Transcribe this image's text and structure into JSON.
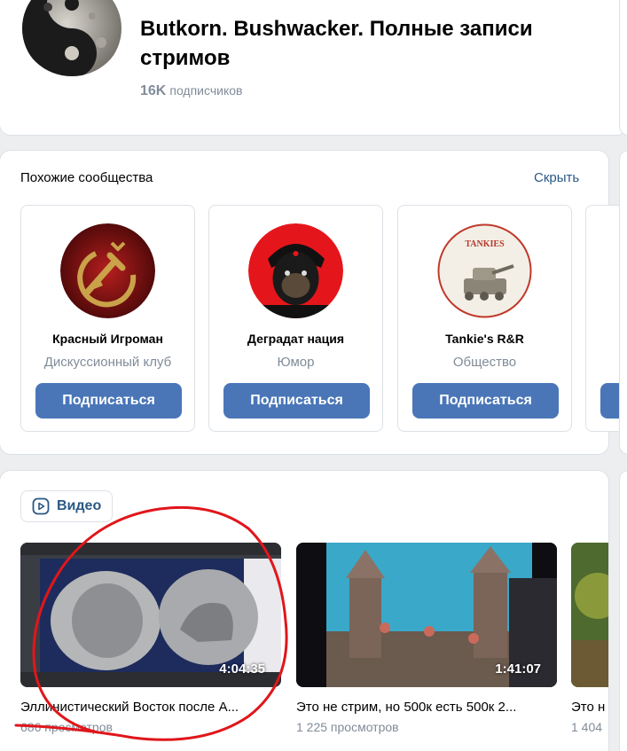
{
  "header": {
    "group_name": "Butkorn. Bushwacker. Полные записи стримов",
    "subscribers_count": "16K",
    "subscribers_label": "подписчиков"
  },
  "similar": {
    "title": "Похожие сообщества",
    "hide_label": "Скрыть",
    "items": [
      {
        "name": "Красный Игроман",
        "category": "Дискуссионный клуб",
        "button": "Подписаться"
      },
      {
        "name": "Деградат нация",
        "category": "Юмор",
        "button": "Подписаться"
      },
      {
        "name": "Tankie's R&R",
        "category": "Общество",
        "button": "Подписаться",
        "logo_text": "TANKIES"
      }
    ]
  },
  "videos": {
    "tab_label": "Видео",
    "items": [
      {
        "title": "Эллинистический Восток после А...",
        "views": "686 просмотров",
        "duration": "4:04:35"
      },
      {
        "title": "Это не стрим, но 500к есть 500к 2...",
        "views": "1 225 просмотров",
        "duration": "1:41:07"
      },
      {
        "title": "Это н",
        "views": "1 404",
        "duration": ""
      }
    ]
  },
  "colors": {
    "accent_button": "#4a76b8",
    "link": "#2a5885",
    "secondary_text": "#818c99",
    "annotation_red": "#e0161b"
  }
}
